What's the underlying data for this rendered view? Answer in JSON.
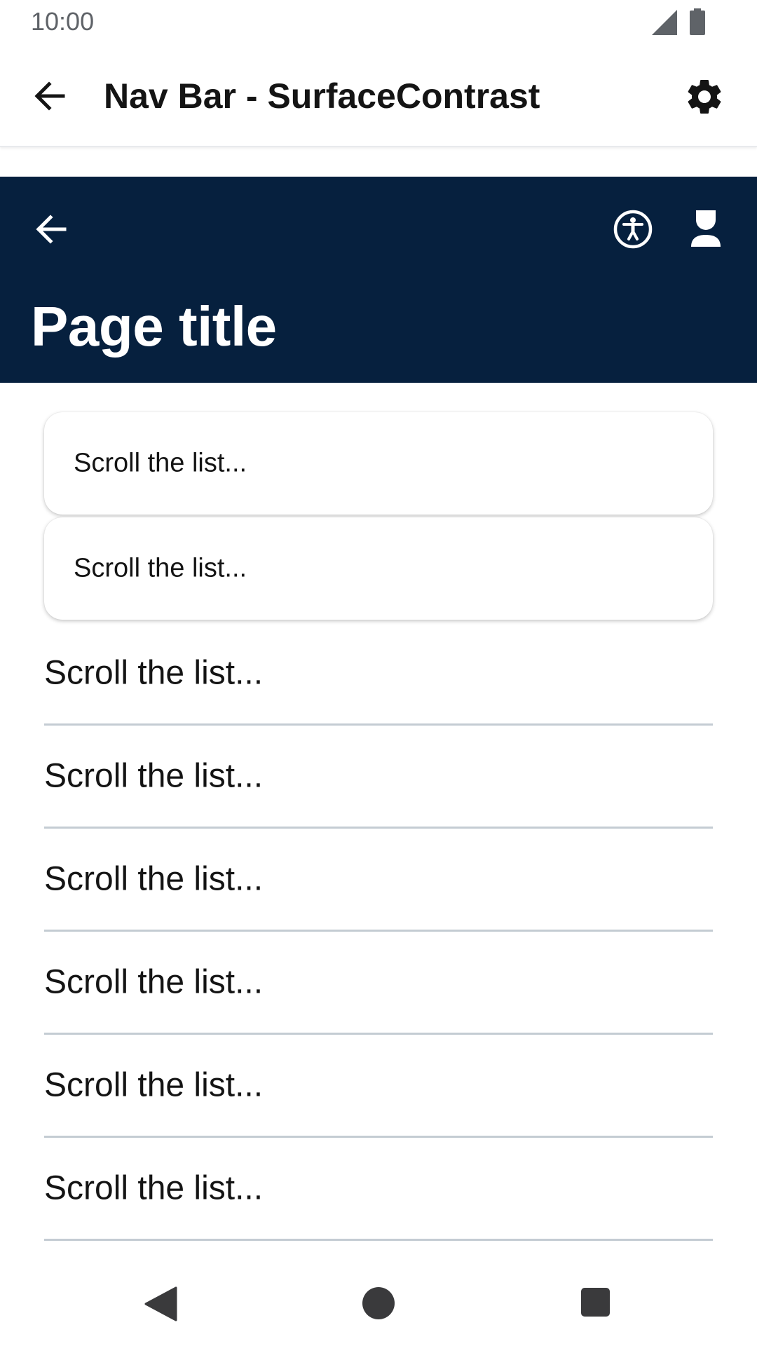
{
  "status_bar": {
    "time": "10:00",
    "icons": [
      "signal-icon",
      "battery-icon"
    ]
  },
  "app_bar": {
    "back_icon": "arrow-left-icon",
    "title": "Nav Bar - SurfaceContrast",
    "settings_icon": "gear-icon"
  },
  "nav_bar": {
    "background_color": "#06203e",
    "back_icon": "arrow-left-icon",
    "accessibility_icon": "accessibility-icon",
    "profile_icon": "user-icon",
    "page_title": "Page title"
  },
  "cards": [
    {
      "label": "Scroll the list..."
    },
    {
      "label": "Scroll the list..."
    }
  ],
  "list": [
    {
      "label": "Scroll the list..."
    },
    {
      "label": "Scroll the list..."
    },
    {
      "label": "Scroll the list..."
    },
    {
      "label": "Scroll the list..."
    },
    {
      "label": "Scroll the list..."
    },
    {
      "label": "Scroll the list..."
    }
  ],
  "system_nav": {
    "icons": [
      "back-triangle-icon",
      "home-circle-icon",
      "recents-square-icon"
    ]
  }
}
